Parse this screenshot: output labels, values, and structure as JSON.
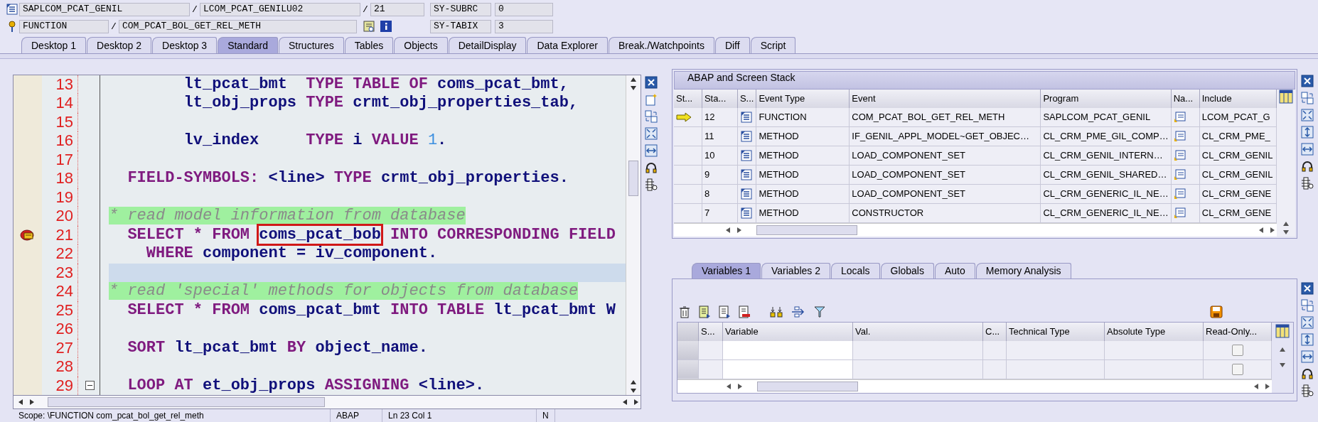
{
  "header": {
    "program": "SAPLCOM_PCAT_GENIL",
    "separator_1": "/",
    "include": "LCOM_PCAT_GENILU02",
    "separator_2": "/",
    "line": "21",
    "event_type": "FUNCTION",
    "separator_3": "/",
    "event": "COM_PCAT_BOL_GET_REL_METH",
    "sy_fields": [
      {
        "name": "SY-SUBRC",
        "value": "0"
      },
      {
        "name": "SY-TABIX",
        "value": "3"
      }
    ]
  },
  "main_tabs": [
    {
      "label": "Desktop 1",
      "selected": false
    },
    {
      "label": "Desktop 2",
      "selected": false
    },
    {
      "label": "Desktop 3",
      "selected": false
    },
    {
      "label": "Standard",
      "selected": true
    },
    {
      "label": "Structures",
      "selected": false
    },
    {
      "label": "Tables",
      "selected": false
    },
    {
      "label": "Objects",
      "selected": false
    },
    {
      "label": "DetailDisplay",
      "selected": false
    },
    {
      "label": "Data Explorer",
      "selected": false
    },
    {
      "label": "Break./Watchpoints",
      "selected": false
    },
    {
      "label": "Diff",
      "selected": false
    },
    {
      "label": "Script",
      "selected": false
    }
  ],
  "editor": {
    "lines": [
      {
        "number": "13",
        "current": false,
        "marker": false,
        "foldable": false,
        "tokens": [
          {
            "kind": "ident",
            "text": "        lt_pcat_bmt  "
          },
          {
            "kind": "keyword",
            "text": "TYPE TABLE OF "
          },
          {
            "kind": "ident",
            "text": "coms_pcat_bmt,"
          }
        ]
      },
      {
        "number": "14",
        "current": false,
        "marker": false,
        "foldable": false,
        "tokens": [
          {
            "kind": "ident",
            "text": "        lt_obj_props "
          },
          {
            "kind": "keyword",
            "text": "TYPE "
          },
          {
            "kind": "ident",
            "text": "crmt_obj_properties_tab,"
          }
        ]
      },
      {
        "number": "15",
        "current": false,
        "marker": false,
        "foldable": false
      },
      {
        "number": "16",
        "current": false,
        "marker": false,
        "foldable": false,
        "tokens": [
          {
            "kind": "ident",
            "text": "        lv_index     "
          },
          {
            "kind": "keyword",
            "text": "TYPE "
          },
          {
            "kind": "ident",
            "text": "i "
          },
          {
            "kind": "keyword",
            "text": "VALUE "
          },
          {
            "kind": "number",
            "text": "1"
          },
          {
            "kind": "ident",
            "text": "."
          }
        ]
      },
      {
        "number": "17",
        "current": false,
        "marker": false,
        "foldable": false
      },
      {
        "number": "18",
        "current": false,
        "marker": false,
        "foldable": false,
        "tokens": [
          {
            "kind": "keyword",
            "text": "  FIELD-SYMBOLS: "
          },
          {
            "kind": "ident",
            "text": "<line> "
          },
          {
            "kind": "keyword",
            "text": "TYPE "
          },
          {
            "kind": "ident",
            "text": "crmt_obj_properties."
          }
        ]
      },
      {
        "number": "19",
        "current": false,
        "marker": false,
        "foldable": false
      },
      {
        "number": "20",
        "current": false,
        "marker": false,
        "foldable": false,
        "tokens": [
          {
            "kind": "comment",
            "text": "* read model information from database"
          }
        ]
      },
      {
        "number": "21",
        "current": false,
        "marker": true,
        "foldable": false,
        "tokens": [
          {
            "kind": "keyword",
            "text": "  SELECT * FROM "
          },
          {
            "kind": "ident",
            "text": "coms_pcat_bob",
            "boxed": true
          },
          {
            "kind": "keyword",
            "text": " INTO CORRESPONDING FIELD"
          }
        ]
      },
      {
        "number": "22",
        "current": false,
        "marker": false,
        "foldable": false,
        "tokens": [
          {
            "kind": "keyword",
            "text": "    WHERE "
          },
          {
            "kind": "ident",
            "text": "component = iv_component."
          }
        ]
      },
      {
        "number": "23",
        "current": true,
        "marker": false,
        "foldable": false
      },
      {
        "number": "24",
        "current": false,
        "marker": false,
        "foldable": false,
        "tokens": [
          {
            "kind": "comment",
            "text": "* read 'special' methods for objects from database"
          }
        ]
      },
      {
        "number": "25",
        "current": false,
        "marker": false,
        "foldable": false,
        "tokens": [
          {
            "kind": "keyword",
            "text": "  SELECT * FROM "
          },
          {
            "kind": "ident",
            "text": "coms_pcat_bmt "
          },
          {
            "kind": "keyword",
            "text": "INTO TABLE "
          },
          {
            "kind": "ident",
            "text": "lt_pcat_bmt W"
          }
        ]
      },
      {
        "number": "26",
        "current": false,
        "marker": false,
        "foldable": false
      },
      {
        "number": "27",
        "current": false,
        "marker": false,
        "foldable": false,
        "tokens": [
          {
            "kind": "keyword",
            "text": "  SORT "
          },
          {
            "kind": "ident",
            "text": "lt_pcat_bmt "
          },
          {
            "kind": "keyword",
            "text": "BY "
          },
          {
            "kind": "ident",
            "text": "object_name."
          }
        ]
      },
      {
        "number": "28",
        "current": false,
        "marker": false,
        "foldable": false
      },
      {
        "number": "29",
        "current": false,
        "marker": false,
        "foldable": true,
        "tokens": [
          {
            "kind": "keyword",
            "text": "  LOOP AT "
          },
          {
            "kind": "ident",
            "text": "et_obj_props "
          },
          {
            "kind": "keyword",
            "text": "ASSIGNING "
          },
          {
            "kind": "ident",
            "text": "<line>."
          }
        ]
      }
    ],
    "status": {
      "scope": "Scope: \\FUNCTION com_pcat_bol_get_rel_meth",
      "language": "ABAP",
      "position": "Ln 23 Col 1",
      "mode": "N"
    }
  },
  "stack": {
    "title": "ABAP and Screen Stack",
    "columns": [
      "St...",
      "Sta...",
      "S...",
      "Event Type",
      "Event",
      "Program",
      "Na...",
      "Include"
    ],
    "rows": [
      {
        "current": true,
        "level": "12",
        "event_type": "FUNCTION",
        "event": "COM_PCAT_BOL_GET_REL_METH",
        "program": "SAPLCOM_PCAT_GENIL",
        "include": "LCOM_PCAT_G"
      },
      {
        "current": false,
        "level": "11",
        "event_type": "METHOD",
        "event": "IF_GENIL_APPL_MODEL~GET_OBJEC…",
        "program": "CL_CRM_PME_GIL_COMP…",
        "include": "CL_CRM_PME_"
      },
      {
        "current": false,
        "level": "10",
        "event_type": "METHOD",
        "event": "LOAD_COMPONENT_SET",
        "program": "CL_CRM_GENIL_INTERN…",
        "include": "CL_CRM_GENIL"
      },
      {
        "current": false,
        "level": "9",
        "event_type": "METHOD",
        "event": "LOAD_COMPONENT_SET",
        "program": "CL_CRM_GENIL_SHARED…",
        "include": "CL_CRM_GENIL"
      },
      {
        "current": false,
        "level": "8",
        "event_type": "METHOD",
        "event": "LOAD_COMPONENT_SET",
        "program": "CL_CRM_GENERIC_IL_NE…",
        "include": "CL_CRM_GENE"
      },
      {
        "current": false,
        "level": "7",
        "event_type": "METHOD",
        "event": "CONSTRUCTOR",
        "program": "CL_CRM_GENERIC_IL_NE…",
        "include": "CL_CRM_GENE"
      }
    ]
  },
  "variables": {
    "tabs": [
      {
        "label": "Variables 1",
        "selected": true
      },
      {
        "label": "Variables 2",
        "selected": false
      },
      {
        "label": "Locals",
        "selected": false
      },
      {
        "label": "Globals",
        "selected": false
      },
      {
        "label": "Auto",
        "selected": false
      },
      {
        "label": "Memory Analysis",
        "selected": false
      }
    ],
    "columns": [
      "S...",
      "Variable",
      "Val.",
      "C...",
      "Technical Type",
      "Absolute Type",
      "Read-Only..."
    ],
    "rows": [
      {
        "read_only": false
      },
      {
        "read_only": false
      }
    ]
  }
}
